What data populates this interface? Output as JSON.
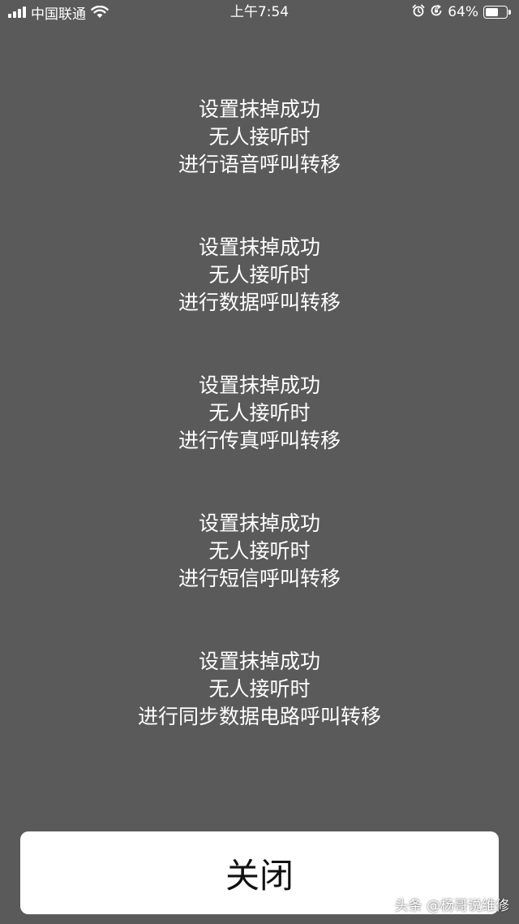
{
  "status_bar": {
    "carrier": "中国联通",
    "time": "上午7:54",
    "battery_percent": "64%",
    "battery_level": 0.64,
    "icons": [
      "signal-icon",
      "wifi-icon",
      "alarm-icon",
      "orientation-lock-icon",
      "battery-icon"
    ]
  },
  "messages": [
    {
      "line1": "设置抹掉成功",
      "line2": "无人接听时",
      "line3": "进行语音呼叫转移"
    },
    {
      "line1": "设置抹掉成功",
      "line2": "无人接听时",
      "line3": "进行数据呼叫转移"
    },
    {
      "line1": "设置抹掉成功",
      "line2": "无人接听时",
      "line3": "进行传真呼叫转移"
    },
    {
      "line1": "设置抹掉成功",
      "line2": "无人接听时",
      "line3": "进行短信呼叫转移"
    },
    {
      "line1": "设置抹掉成功",
      "line2": "无人接听时",
      "line3": "进行同步数据电路呼叫转移"
    }
  ],
  "close_button": {
    "label": "关闭"
  },
  "watermark": {
    "text": "头条 @杨哥说维修"
  },
  "colors": {
    "background": "#5a5a5a",
    "text": "#ffffff",
    "button_bg": "#ffffff",
    "button_text": "#111111"
  }
}
